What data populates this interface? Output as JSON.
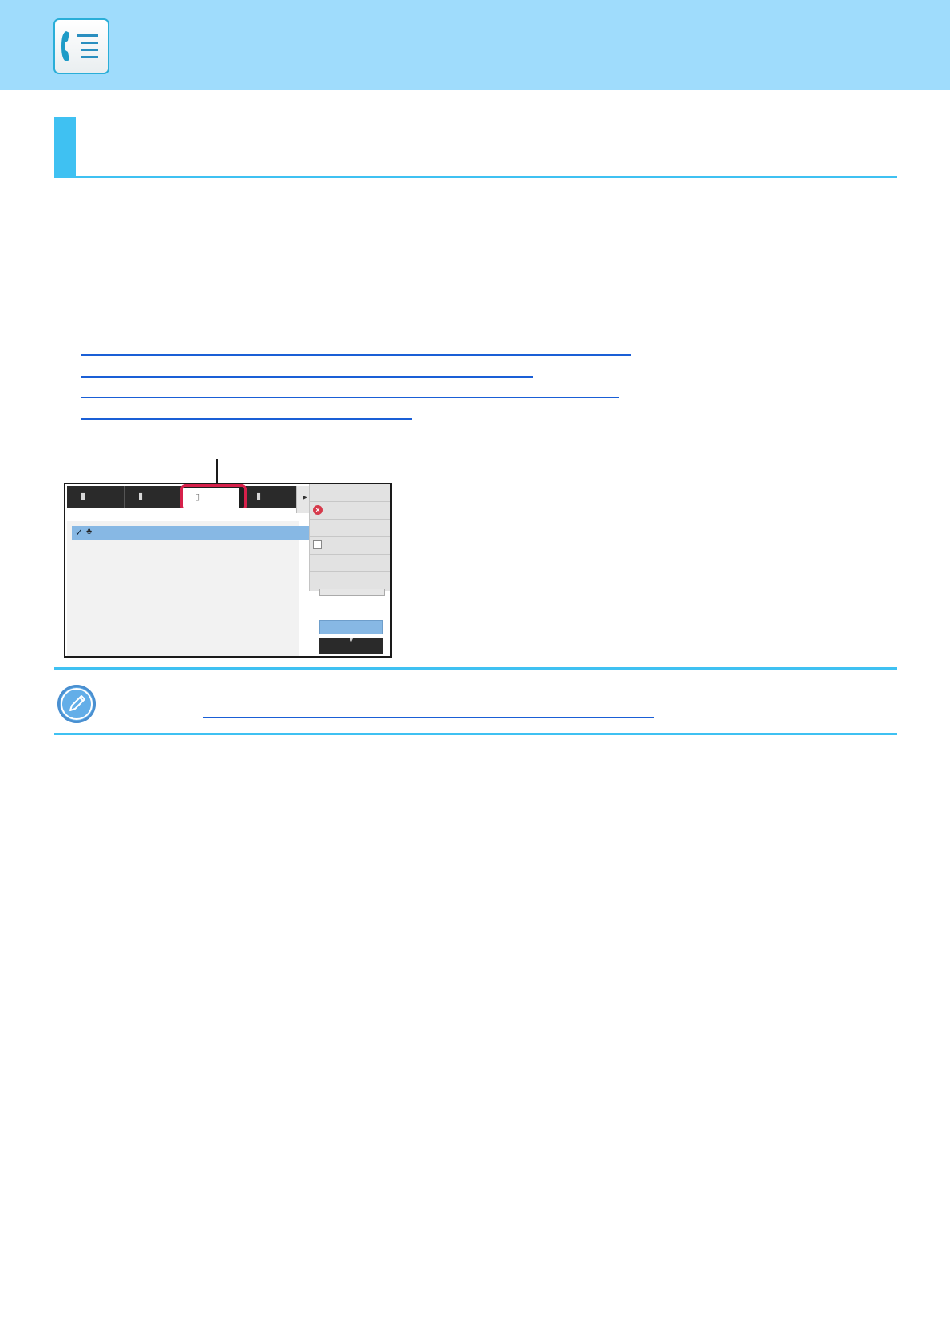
{
  "header": {
    "app_icon": "fax-address-book-icon",
    "accent_color": "#9fdcfc"
  },
  "section": {
    "accent_color": "#3fc1f2"
  },
  "links": {
    "link_color": "#1a5fd6"
  },
  "screen": {
    "tabs": [
      {
        "icon": "document-icon"
      },
      {
        "icon": "documents-icon"
      },
      {
        "icon": "address-book-icon",
        "active": true
      },
      {
        "icon": "history-icon"
      }
    ],
    "highlight_color": "#d6204a",
    "selected_row_color": "#87b8e4",
    "side_panel_items": [
      {
        "icon": ""
      },
      {
        "icon": "cancel-icon"
      },
      {
        "icon": ""
      },
      {
        "icon": "checkbox-icon"
      },
      {
        "icon": ""
      },
      {
        "icon": ""
      }
    ]
  },
  "note": {
    "icon": "pencil-note-icon"
  }
}
